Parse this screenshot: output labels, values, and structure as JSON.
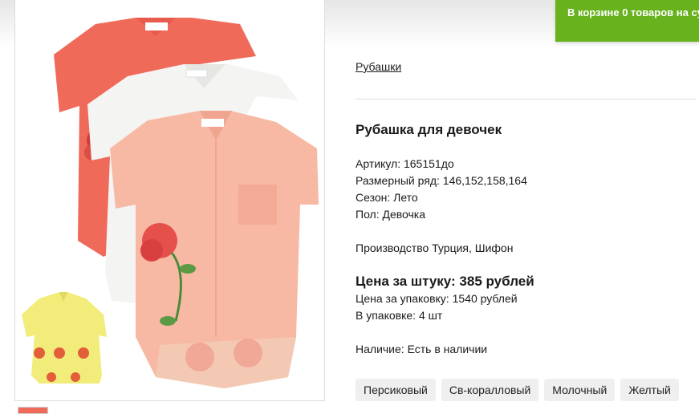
{
  "cart": {
    "prefix": "В корзине",
    "count": "0 товаров",
    "suffix": "на сумму"
  },
  "breadcrumb": "Рубашки",
  "product": {
    "title": "Рубашка для девочек",
    "article": "Артикул: 165151до",
    "sizes": "Размерный ряд: 146,152,158,164",
    "season": "Сезон: Лето",
    "gender": "Пол: Девочка",
    "production": "Производство Турция, Шифон",
    "price_unit": "Цена за штуку: 385 рублей",
    "price_pack": "Цена за упаковку: 1540 рублей",
    "in_pack": "В упаковке: 4 шт",
    "availability": "Наличие: Есть в наличии"
  },
  "colors": [
    "Персиковый",
    "Св-коралловый",
    "Молочный",
    "Желтый"
  ],
  "palette": {
    "accent": "#67b21d",
    "peach": "#f7b9a4",
    "coral": "#f06a5a",
    "milk": "#f4f4f2",
    "yellow": "#f2ec7a"
  }
}
